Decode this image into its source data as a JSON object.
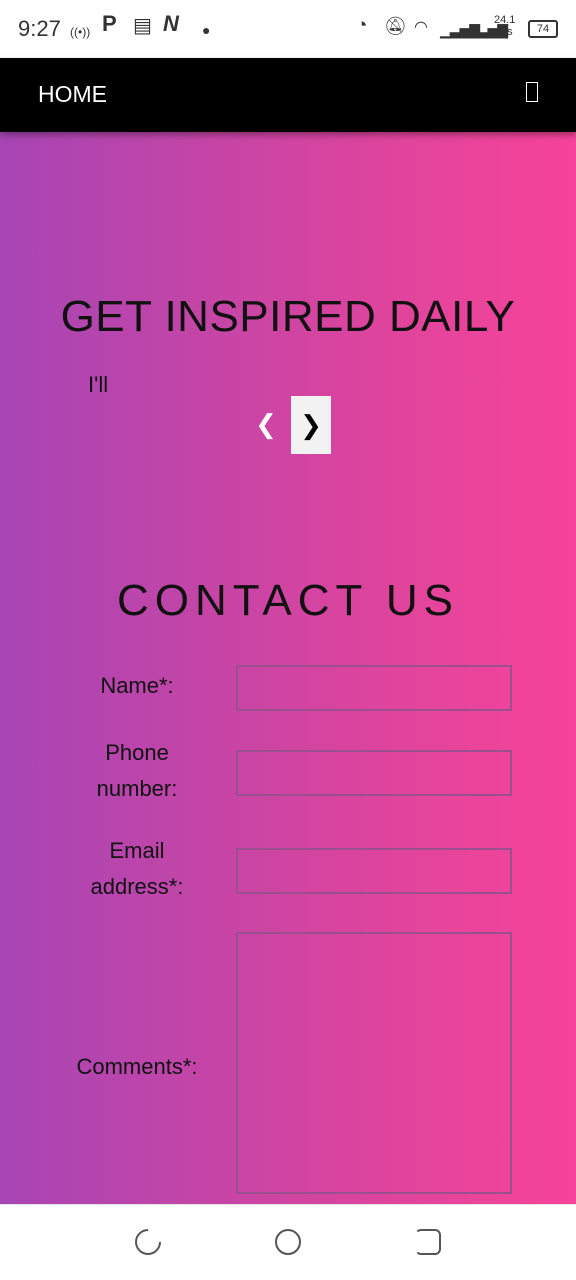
{
  "status_bar": {
    "time": "9:27",
    "net_speed_value": "24.1",
    "net_speed_unit": "K/s",
    "battery": "74",
    "icons": [
      "broadcast-icon",
      "parking-icon",
      "news-icon",
      "n-app-icon",
      "dot-icon",
      "data-saver-icon",
      "bell-off-icon",
      "wifi-icon",
      "signal-icon",
      "signal-icon"
    ]
  },
  "nav": {
    "home_label": "HOME",
    "menu_icon": "menu-icon"
  },
  "hero": {
    "title": "GET INSPIRED DAILY",
    "quote": "I'll",
    "prev_symbol": "❮",
    "next_symbol": "❯"
  },
  "contact": {
    "title": "CONTACT US",
    "name_label": "Name*:",
    "phone_label_line1": "Phone",
    "phone_label_line2": "number:",
    "email_label_line1": "Email",
    "email_label_line2": "address*:",
    "comments_label": "Comments*:",
    "name_value": "",
    "phone_value": "",
    "email_value": "",
    "comments_value": ""
  },
  "system_nav": {
    "recent": "recent-apps-icon",
    "home": "home-circle-icon",
    "back": "back-icon"
  },
  "colors": {
    "gradient_left": "#a745b5",
    "gradient_right": "#f7439a",
    "nav_bg": "#000000",
    "input_border": "#9a4f8e"
  }
}
